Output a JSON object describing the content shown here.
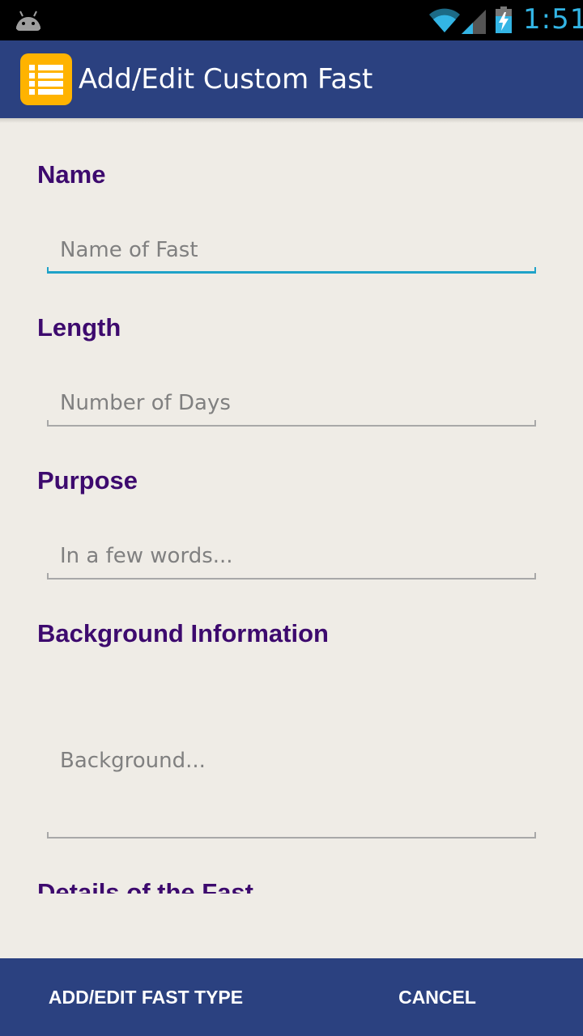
{
  "status_bar": {
    "time": "1:51",
    "icons": [
      "android-icon",
      "wifi-icon",
      "signal-icon",
      "battery-charging-icon"
    ],
    "accent": "#33b5e5"
  },
  "action_bar": {
    "title": "Add/Edit Custom Fast",
    "icon": "list-icon",
    "background": "#2b4180",
    "icon_color": "#ffb300"
  },
  "form": {
    "name": {
      "label": "Name",
      "placeholder": "Name of Fast",
      "value": ""
    },
    "length": {
      "label": "Length",
      "placeholder": "Number of Days",
      "value": ""
    },
    "purpose": {
      "label": "Purpose",
      "placeholder": "In a few words...",
      "value": ""
    },
    "background": {
      "label": "Background Information",
      "placeholder": "Background...",
      "value": ""
    },
    "details": {
      "label": "Details of the Fast"
    },
    "label_color": "#3d0a6e",
    "focus_color": "#1fa2c8"
  },
  "bottom_bar": {
    "add_label": "ADD/EDIT FAST TYPE",
    "cancel_label": "CANCEL"
  }
}
